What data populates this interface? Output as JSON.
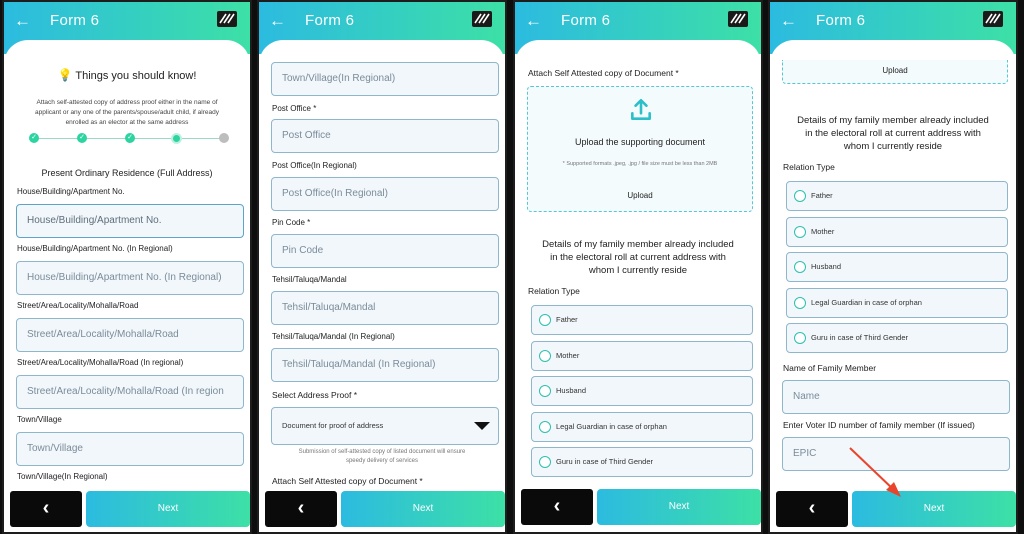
{
  "header": {
    "title": "Form 6",
    "back": "←"
  },
  "screen1": {
    "info_title": "Things you should know!",
    "info_text_1": "Attach self-attested copy of address proof either in the name of",
    "info_text_2": "applicant or any one of the parents/spouse/adult child, if already",
    "info_text_3": "enrolled as an elector at the same address",
    "section_title": "Present Ordinary Residence (Full Address)",
    "fields": [
      {
        "label": "House/Building/Apartment No.",
        "placeholder": "House/Building/Apartment No."
      },
      {
        "label": "House/Building/Apartment No. (In Regional)",
        "placeholder": "House/Building/Apartment No. (In Regional)"
      },
      {
        "label": "Street/Area/Locality/Mohalla/Road",
        "placeholder": "Street/Area/Locality/Mohalla/Road"
      },
      {
        "label": "Street/Area/Locality/Mohalla/Road (In regional)",
        "placeholder": "Street/Area/Locality/Mohalla/Road (In region"
      },
      {
        "label": "Town/Village",
        "placeholder": "Town/Village"
      }
    ],
    "last_label": "Town/Village(In Regional)",
    "next": "Next",
    "back_btn": "‹",
    "steps": [
      "✓",
      "✓",
      "✓",
      "",
      ""
    ]
  },
  "screen2": {
    "top_placeholder": "Town/Village(In Regional)",
    "fields": [
      {
        "label": "Post Office *",
        "placeholder": "Post Office"
      },
      {
        "label": "Post Office(In Regional)",
        "placeholder": "Post Office(In Regional)"
      },
      {
        "label": "Pin Code *",
        "placeholder": "Pin Code"
      },
      {
        "label": "Tehsil/Taluqa/Mandal",
        "placeholder": "Tehsil/Taluqa/Mandal"
      },
      {
        "label": "Tehsil/Taluqa/Mandal (In Regional)",
        "placeholder": "Tehsil/Taluqa/Mandal (In Regional)"
      }
    ],
    "select_label": "Select Address Proof *",
    "select_value": "Document for proof of address",
    "note_1": "Submission of self-attested copy of listed document will ensure",
    "note_2": "speedy delivery of services",
    "attach_label": "Attach Self Attested copy of Document *",
    "next": "Next",
    "back_btn": "‹"
  },
  "screen3": {
    "attach_label": "Attach Self Attested copy of Document *",
    "upload_title": "Upload the supporting document",
    "upload_note": "* Supported formats .jpeg, .jpg / file size must be less than 2MB",
    "upload_btn": "Upload",
    "family_text_1": "Details of my family member already included",
    "family_text_2": "in the electoral roll at current address with",
    "family_text_3": "whom I currently reside",
    "relation_label": "Relation Type",
    "relations": [
      "Father",
      "Mother",
      "Husband",
      "Legal Guardian in case of orphan",
      "Guru in case of Third Gender"
    ],
    "next": "Next",
    "back_btn": "‹"
  },
  "screen4": {
    "upload_btn": "Upload",
    "family_text_1": "Details of my family member already included",
    "family_text_2": "in the electoral roll at current address with",
    "family_text_3": "whom I currently reside",
    "relation_label": "Relation Type",
    "relations": [
      "Father",
      "Mother",
      "Husband",
      "Legal Guardian in case of orphan",
      "Guru in case of Third Gender"
    ],
    "name_label": "Name of Family Member",
    "name_placeholder": "Name",
    "epic_label": "Enter Voter ID number of family member (If issued)",
    "epic_placeholder": "EPIC",
    "next": "Next",
    "back_btn": "‹"
  },
  "colors": {
    "accent_start": "#2cbbe0",
    "accent_end": "#3de0a6",
    "arrow": "#e8452c"
  }
}
